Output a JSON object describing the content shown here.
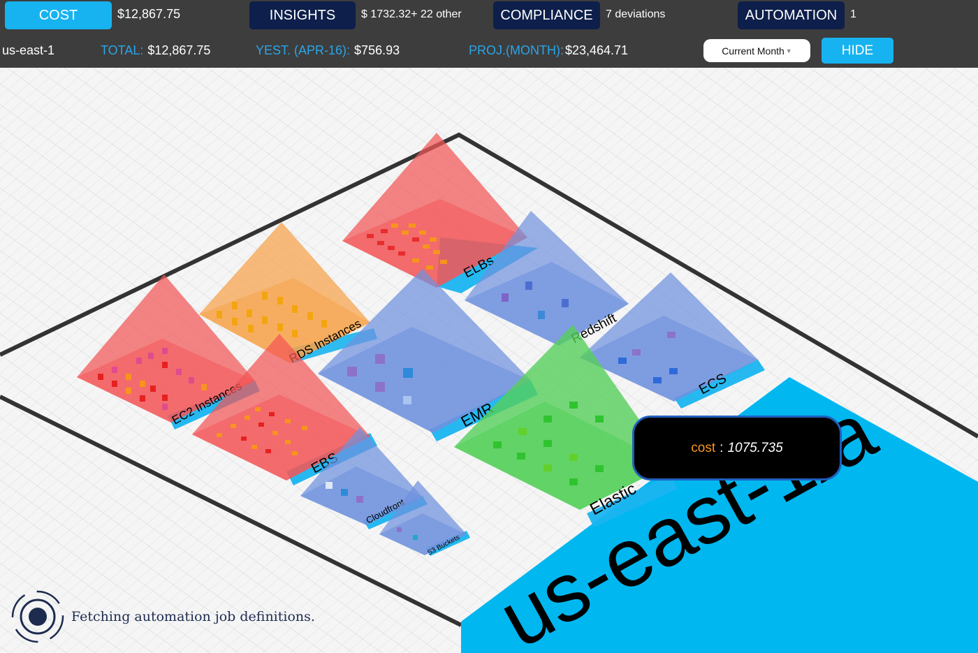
{
  "tabs": {
    "cost": {
      "label": "COST",
      "value": "$12,867.75"
    },
    "insights": {
      "label": "INSIGHTS",
      "value": "$ 1732.32+ 22 other"
    },
    "compliance": {
      "label": "COMPLIANCE",
      "value": "7 deviations"
    },
    "automation": {
      "label": "AUTOMATION",
      "value": "1"
    }
  },
  "summary": {
    "region": "us-east-1",
    "total_label": "TOTAL:",
    "total_value": "$12,867.75",
    "yesterday_label": "YEST. (APR-16):",
    "yesterday_value": "$756.93",
    "projected_label": "PROJ.(MONTH):",
    "projected_value": "$23,464.71"
  },
  "period_select": {
    "value": "Current Month"
  },
  "hide_button": {
    "label": "HIDE"
  },
  "scene": {
    "region_banner": "us-east-1/a",
    "services": {
      "ec2": "EC2 Instances",
      "rds": "RDS Instances",
      "elbs": "ELBs",
      "redshift": "Redshift",
      "emr": "EMR",
      "ecs": "ECS",
      "ebs": "EBS",
      "elastic": "Elastic",
      "cloudfront": "Cloudfront",
      "s3": "S3 Buckets"
    }
  },
  "tooltip": {
    "key": "cost",
    "separator": ":",
    "value": "1075.735"
  },
  "status": {
    "loading_text": "Fetching automation job definitions."
  },
  "colors": {
    "accent": "#17b3f0",
    "tab_dark": "#0d1f4a",
    "red": "#f25656",
    "orange": "#f7a24a",
    "blue": "#6f92de",
    "green": "#55cf5a",
    "tooltip_key": "#f7941d"
  }
}
